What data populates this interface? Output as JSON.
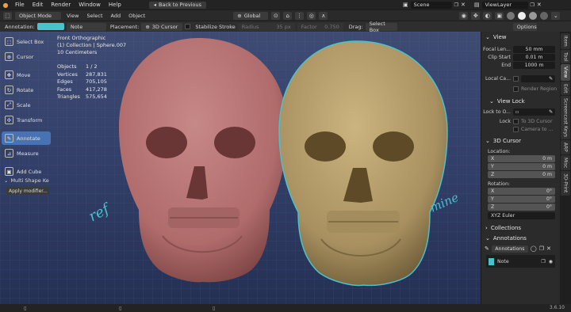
{
  "app": {
    "menu": [
      "File",
      "Edit",
      "Render",
      "Window",
      "Help"
    ],
    "back_button": "Back to Previous",
    "scene_name": "Scene",
    "view_layer": "ViewLayer"
  },
  "header": {
    "mode": "Object Mode",
    "menus": [
      "View",
      "Select",
      "Add",
      "Object"
    ],
    "transform_orientation": "Global"
  },
  "tool_settings": {
    "annotation_label": "Annotation:",
    "layer_name": "Note",
    "placement_label": "Placement:",
    "placement_value": "3D Cursor",
    "stabilize_label": "Stabilize Stroke",
    "radius_label": "Radius",
    "radius_value": "35 px",
    "factor_label": "Factor",
    "factor_value": "0.750",
    "drag_label": "Drag:",
    "drag_value": "Select Box",
    "options_label": "Options",
    "annotation_color": "#49c2cc"
  },
  "toolbar": {
    "tools": [
      {
        "label": "Select Box",
        "icon": "select-box-icon",
        "active": false
      },
      {
        "label": "Cursor",
        "icon": "cursor-icon",
        "active": false
      },
      {
        "label": "Move",
        "icon": "move-icon",
        "active": false
      },
      {
        "label": "Rotate",
        "icon": "rotate-icon",
        "active": false
      },
      {
        "label": "Scale",
        "icon": "scale-icon",
        "active": false
      },
      {
        "label": "Transform",
        "icon": "transform-icon",
        "active": false
      },
      {
        "label": "Annotate",
        "icon": "annotate-icon",
        "active": true
      },
      {
        "label": "Measure",
        "icon": "measure-icon",
        "active": false
      },
      {
        "label": "Add Cube",
        "icon": "add-cube-icon",
        "active": false
      }
    ],
    "multi_shape_title": "Multi Shape Ke",
    "apply_modifier": "Apply modifier..."
  },
  "viewport": {
    "view_name": "Front Orthographic",
    "collection": "(1) Collection | Sphere.007",
    "scale": "10 Centimeters",
    "stats": [
      {
        "label": "Objects",
        "value": "1 / 2",
        "extra": ""
      },
      {
        "label": "Vertices",
        "value": "287,831",
        "extra": ""
      },
      {
        "label": "Edges",
        "value": "705,105",
        "extra": ""
      },
      {
        "label": "Faces",
        "value": "417,278",
        "extra": ""
      },
      {
        "label": "Triangles",
        "value": "575,654",
        "extra": ""
      }
    ],
    "annotation_left": "ref",
    "annotation_right": "mine",
    "skull_left_color": "#b97373",
    "skull_right_color": "#b9a06a",
    "outline_color": "#49c2cc"
  },
  "sidebar": {
    "view_header": "View",
    "focal_length_label": "Focal Len...",
    "focal_length_value": "50 mm",
    "clip_start_label": "Clip Start",
    "clip_start_value": "0.01 m",
    "clip_end_label": "End",
    "clip_end_value": "1000 m",
    "local_camera_label": "Local Ca...",
    "render_region_label": "Render Region",
    "view_lock_header": "View Lock",
    "lock_to_object_label": "Lock to O...",
    "lock_label": "Lock",
    "to_3d_cursor_label": "To 3D Cursor",
    "camera_to_label": "Camera to ...",
    "cursor_header": "3D Cursor",
    "location_label": "Location:",
    "location": [
      {
        "axis": "X",
        "value": "0 m"
      },
      {
        "axis": "Y",
        "value": "0 m"
      },
      {
        "axis": "Z",
        "value": "0 m"
      }
    ],
    "rotation_label": "Rotation:",
    "rotation": [
      {
        "axis": "X",
        "value": "0°"
      },
      {
        "axis": "Y",
        "value": "0°"
      },
      {
        "axis": "Z",
        "value": "0°"
      }
    ],
    "rotation_mode": "XYZ Euler",
    "collections_header": "Collections",
    "annotations_header": "Annotations",
    "annotations_datablock": "Annotations",
    "note_layer": "Note"
  },
  "tabs": [
    "Item",
    "Tool",
    "View",
    "Edit",
    "Screencast Keys",
    "ARP",
    "Misc",
    "3D-Print"
  ],
  "active_tab": "View",
  "status": {
    "version": "3.6.10"
  }
}
